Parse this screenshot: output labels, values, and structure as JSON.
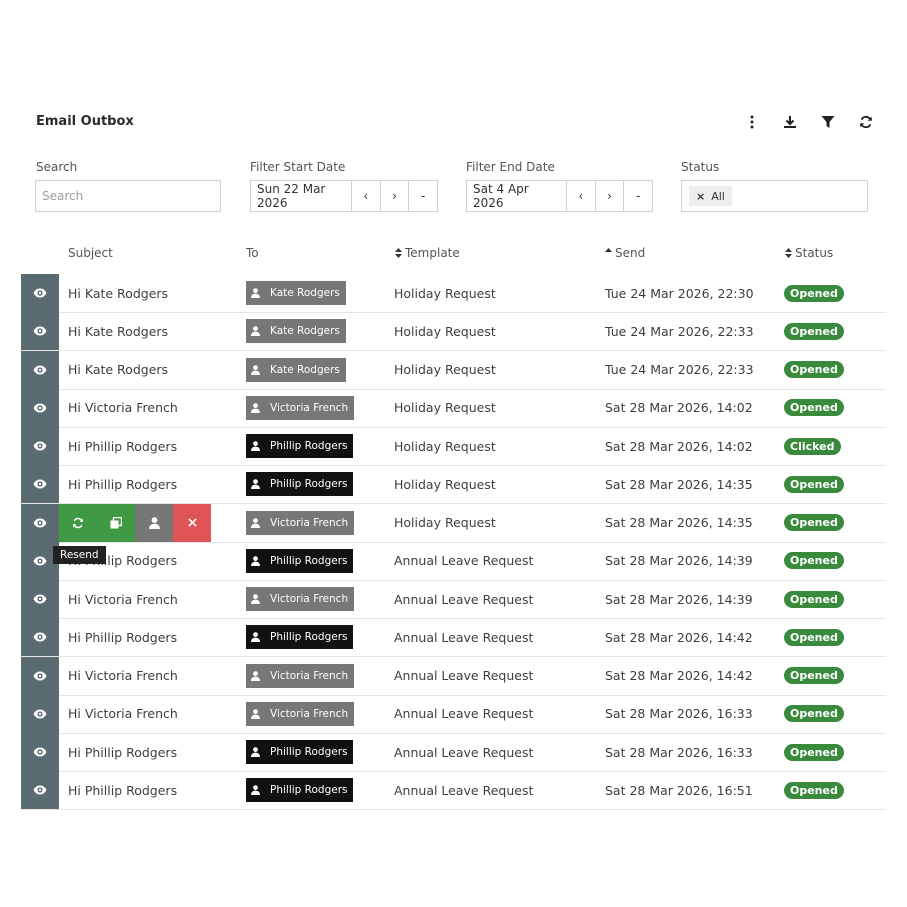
{
  "header": {
    "title": "Email Outbox"
  },
  "toolbar": {
    "icons": [
      "more-vertical-icon",
      "download-icon",
      "filter-icon",
      "refresh-icon"
    ]
  },
  "filters": {
    "search_label": "Search",
    "search_placeholder": "Search",
    "start_label": "Filter Start Date",
    "start_value": "Sun 22 Mar 2026",
    "end_label": "Filter End Date",
    "end_value": "Sat 4 Apr 2026",
    "prev": "‹",
    "next": "›",
    "clear": "-",
    "status_label": "Status",
    "status_chip": "All",
    "status_chip_remove": "×"
  },
  "table": {
    "columns": {
      "subject": "Subject",
      "to": "To",
      "template": "Template",
      "send": "Send",
      "status": "Status"
    },
    "rows": [
      {
        "subject": "Hi Kate Rodgers",
        "to": "Kate Rodgers",
        "to_style": "grey",
        "template": "Holiday Request",
        "send": "Tue 24 Mar 2026, 22:30",
        "status": "Opened"
      },
      {
        "subject": "Hi Kate Rodgers",
        "to": "Kate Rodgers",
        "to_style": "grey",
        "template": "Holiday Request",
        "send": "Tue 24 Mar 2026, 22:33",
        "status": "Opened"
      },
      {
        "subject": "Hi Kate Rodgers",
        "to": "Kate Rodgers",
        "to_style": "grey",
        "template": "Holiday Request",
        "send": "Tue 24 Mar 2026, 22:33",
        "status": "Opened"
      },
      {
        "subject": "Hi Victoria French",
        "to": "Victoria French",
        "to_style": "grey",
        "template": "Holiday Request",
        "send": "Sat 28 Mar 2026, 14:02",
        "status": "Opened"
      },
      {
        "subject": "Hi Phillip Rodgers",
        "to": "Phillip Rodgers",
        "to_style": "black",
        "template": "Holiday Request",
        "send": "Sat 28 Mar 2026, 14:02",
        "status": "Clicked"
      },
      {
        "subject": "Hi Phillip Rodgers",
        "to": "Phillip Rodgers",
        "to_style": "black",
        "template": "Holiday Request",
        "send": "Sat 28 Mar 2026, 14:35",
        "status": "Opened"
      },
      {
        "subject": "",
        "to": "Victoria French",
        "to_style": "grey",
        "template": "Holiday Request",
        "send": "Sat 28 Mar 2026, 14:35",
        "status": "Opened",
        "actions_open": true
      },
      {
        "subject": "Hi Phillip Rodgers",
        "to": "Phillip Rodgers",
        "to_style": "black",
        "template": "Annual Leave Request",
        "send": "Sat 28 Mar 2026, 14:39",
        "status": "Opened"
      },
      {
        "subject": "Hi Victoria French",
        "to": "Victoria French",
        "to_style": "grey",
        "template": "Annual Leave Request",
        "send": "Sat 28 Mar 2026, 14:39",
        "status": "Opened"
      },
      {
        "subject": "Hi Phillip Rodgers",
        "to": "Phillip Rodgers",
        "to_style": "black",
        "template": "Annual Leave Request",
        "send": "Sat 28 Mar 2026, 14:42",
        "status": "Opened"
      },
      {
        "subject": "Hi Victoria French",
        "to": "Victoria French",
        "to_style": "grey",
        "template": "Annual Leave Request",
        "send": "Sat 28 Mar 2026, 14:42",
        "status": "Opened"
      },
      {
        "subject": "Hi Victoria French",
        "to": "Victoria French",
        "to_style": "grey",
        "template": "Annual Leave Request",
        "send": "Sat 28 Mar 2026, 16:33",
        "status": "Opened"
      },
      {
        "subject": "Hi Phillip Rodgers",
        "to": "Phillip Rodgers",
        "to_style": "black",
        "template": "Annual Leave Request",
        "send": "Sat 28 Mar 2026, 16:33",
        "status": "Opened"
      },
      {
        "subject": "Hi Phillip Rodgers",
        "to": "Phillip Rodgers",
        "to_style": "black",
        "template": "Annual Leave Request",
        "send": "Sat 28 Mar 2026, 16:51",
        "status": "Opened"
      }
    ]
  },
  "row_actions": {
    "icons": [
      "resend-icon",
      "duplicate-icon",
      "user-icon",
      "delete-icon"
    ],
    "tooltip": "Resend"
  },
  "colors": {
    "eye_column": "#5a6b72",
    "status_badge": "#3a8a3e",
    "resend": "#3f9a43",
    "delete": "#df5555"
  }
}
